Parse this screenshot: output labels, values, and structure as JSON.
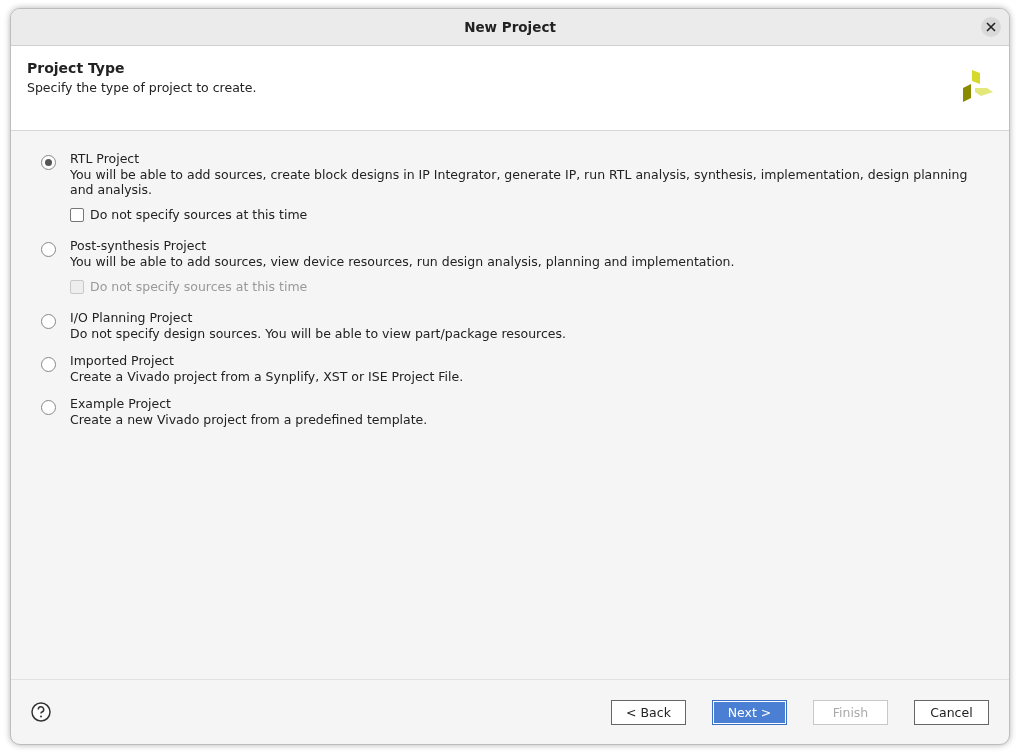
{
  "window": {
    "title": "New Project"
  },
  "header": {
    "title": "Project Type",
    "subtitle": "Specify the type of project to create."
  },
  "options": [
    {
      "label": "RTL Project",
      "description": "You will be able to add sources, create block designs in IP Integrator, generate IP, run RTL analysis, synthesis, implementation, design planning and analysis.",
      "selected": true,
      "checkbox": {
        "label": "Do not specify sources at this time",
        "checked": false,
        "disabled": false
      }
    },
    {
      "label": "Post-synthesis Project",
      "description": "You will be able to add sources, view device resources, run design analysis, planning and implementation.",
      "selected": false,
      "checkbox": {
        "label": "Do not specify sources at this time",
        "checked": false,
        "disabled": true
      }
    },
    {
      "label": "I/O Planning Project",
      "description": "Do not specify design sources. You will be able to view part/package resources.",
      "selected": false
    },
    {
      "label": "Imported Project",
      "description": "Create a Vivado project from a Synplify, XST or ISE Project File.",
      "selected": false
    },
    {
      "label": "Example Project",
      "description": "Create a new Vivado project from a predefined template.",
      "selected": false
    }
  ],
  "buttons": [
    {
      "label": "< Back",
      "default": false,
      "disabled": false
    },
    {
      "label": "Next >",
      "default": true,
      "disabled": false
    },
    {
      "label": "Finish",
      "default": false,
      "disabled": true
    },
    {
      "label": "Cancel",
      "default": false,
      "disabled": false
    }
  ]
}
